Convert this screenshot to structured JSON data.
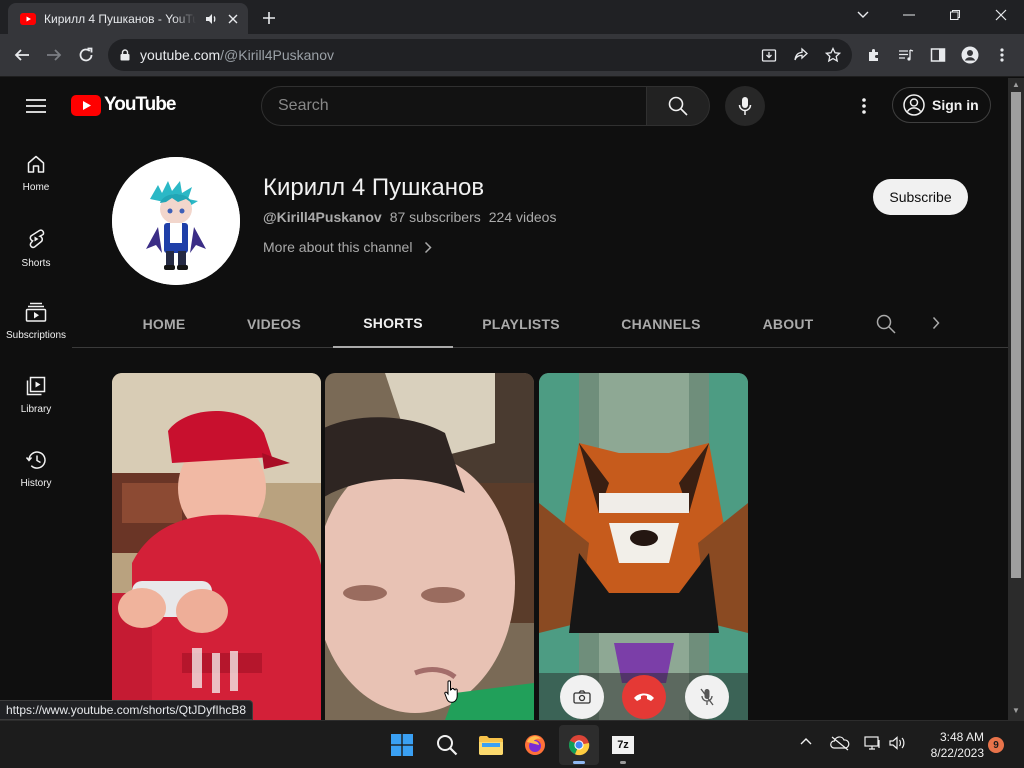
{
  "browser": {
    "tab_title": "Кирилл 4 Пушканов - YouTube",
    "url_host": "youtube.com",
    "url_path": "/@Kirill4Puskanov",
    "status_url": "https://www.youtube.com/shorts/QtJDyfIhcB8"
  },
  "masthead": {
    "logo_text": "YouTube",
    "search_placeholder": "Search",
    "signin_label": "Sign in"
  },
  "guide": {
    "items": [
      {
        "label": "Home",
        "icon": "home-icon"
      },
      {
        "label": "Shorts",
        "icon": "shorts-icon"
      },
      {
        "label": "Subscriptions",
        "icon": "subscriptions-icon"
      },
      {
        "label": "Library",
        "icon": "library-icon"
      },
      {
        "label": "History",
        "icon": "history-icon"
      }
    ]
  },
  "channel": {
    "name": "Кирилл 4 Пушканов",
    "handle": "@Kirill4Puskanov",
    "subscribers": "87 subscribers",
    "videos": "224 videos",
    "more_about": "More about this channel",
    "subscribe_label": "Subscribe"
  },
  "tabs": [
    {
      "label": "HOME",
      "active": false
    },
    {
      "label": "VIDEOS",
      "active": false
    },
    {
      "label": "SHORTS",
      "active": true
    },
    {
      "label": "PLAYLISTS",
      "active": false
    },
    {
      "label": "CHANNELS",
      "active": false
    },
    {
      "label": "ABOUT",
      "active": false
    }
  ],
  "taskbar": {
    "apps": [
      "windows-start",
      "search",
      "file-explorer",
      "firefox",
      "chrome",
      "7zip"
    ],
    "time": "3:48 AM",
    "date": "8/22/2023",
    "notification_count": "9",
    "sevenzip_label": "7z"
  },
  "colors": {
    "youtube_red": "#ff0000",
    "page_bg": "#0f0f0f",
    "chrome_frame": "#202124",
    "chrome_toolbar": "#35363a",
    "end_call_red": "#e53935"
  }
}
